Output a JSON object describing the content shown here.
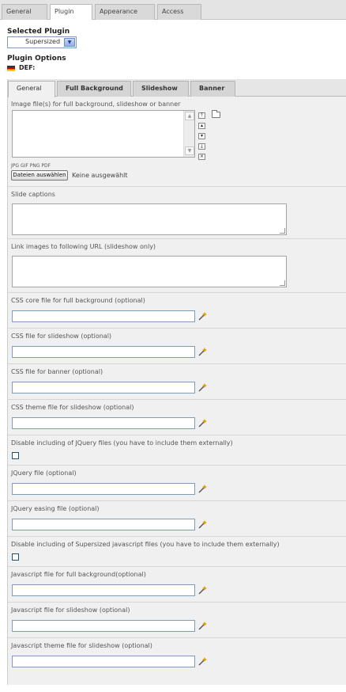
{
  "top_tabs": [
    "General",
    "Plugin",
    "Appearance",
    "Access"
  ],
  "selected_plugin": {
    "label": "Selected Plugin",
    "value": "Supersized"
  },
  "plugin_options": {
    "label": "Plugin Options",
    "language": "DEF:"
  },
  "sub_tabs": [
    "General",
    "Full Background",
    "Slideshow",
    "Banner"
  ],
  "image_field": {
    "label": "Image file(s) for full background, slideshow or banner",
    "filetypes": "JPG GIF PNG PDF",
    "file_button": "Dateien auswählen",
    "file_status": "Keine ausgewählt"
  },
  "captions_label": "Slide captions",
  "link_label": "Link images to following URL (slideshow only)",
  "fields": {
    "css_core": "CSS core file for full background (optional)",
    "css_slideshow": "CSS file for slideshow (optional)",
    "css_banner": "CSS file for banner (optional)",
    "css_theme": "CSS theme file for slideshow (optional)",
    "disable_jquery": "Disable including of JQuery files (you have to include them externally)",
    "jquery_file": "JQuery file (optional)",
    "jquery_easing": "JQuery easing file (optional)",
    "disable_supersized": "Disable including of Supersized javascript files (you have to include them externally)",
    "js_full": "Javascript file for full background(optional)",
    "js_slideshow": "Javascript file for slideshow (optional)",
    "js_theme": "Javascript theme file for slideshow (optional)"
  },
  "icons": {
    "wizard": "wizard-wand-icon",
    "folder": "folder-icon",
    "move_top": "move-top-icon",
    "move_up": "move-up-icon",
    "move_down": "move-down-icon",
    "move_bottom": "move-bottom-icon",
    "delete": "delete-icon"
  },
  "colors": {
    "input_border": "#7f9db9",
    "panel_bg": "#f0f0f0"
  }
}
